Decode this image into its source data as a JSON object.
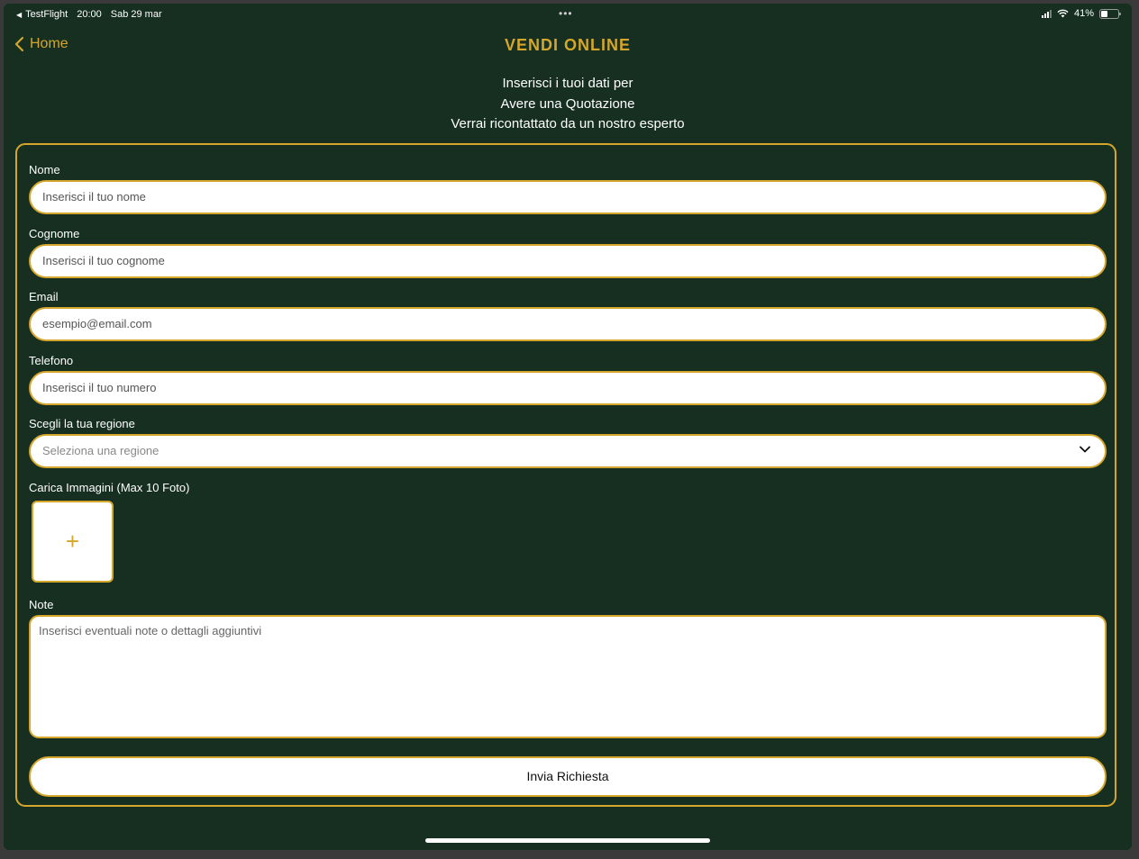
{
  "status_bar": {
    "app": "TestFlight",
    "time": "20:00",
    "date": "Sab 29 mar",
    "battery_text": "41%",
    "battery_level": 0.41,
    "dots": "•••"
  },
  "nav": {
    "back_label": "Home",
    "title": "VENDI ONLINE"
  },
  "intro": [
    "Inserisci i tuoi dati per",
    "Avere una Quotazione",
    "Verrai ricontattato da un nostro esperto"
  ],
  "form": {
    "nome": {
      "label": "Nome",
      "placeholder": "Inserisci il tuo nome"
    },
    "cognome": {
      "label": "Cognome",
      "placeholder": "Inserisci il tuo cognome"
    },
    "email": {
      "label": "Email",
      "placeholder": "esempio@email.com"
    },
    "telefono": {
      "label": "Telefono",
      "placeholder": "Inserisci il tuo numero"
    },
    "regione": {
      "label": "Scegli la tua regione",
      "placeholder": "Seleziona una regione"
    },
    "immagini": {
      "label": "Carica Immagini (Max 10 Foto)",
      "add_symbol": "+"
    },
    "note": {
      "label": "Note",
      "placeholder": "Inserisci eventuali note o dettagli aggiuntivi"
    },
    "submit_label": "Invia Richiesta"
  },
  "colors": {
    "background": "#162f21",
    "accent": "#d4a72c",
    "text": "#ffffff"
  }
}
